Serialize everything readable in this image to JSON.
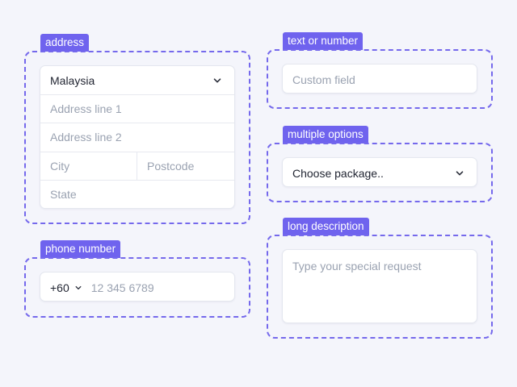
{
  "address": {
    "tag": "address",
    "country": "Malaysia",
    "line1_placeholder": "Address line 1",
    "line2_placeholder": "Address line 2",
    "city_placeholder": "City",
    "postcode_placeholder": "Postcode",
    "state_placeholder": "State"
  },
  "phone": {
    "tag": "phone number",
    "code": "+60",
    "placeholder": "12 345 6789"
  },
  "text_number": {
    "tag": "text or number",
    "placeholder": "Custom field"
  },
  "multiple": {
    "tag": "multiple options",
    "selected": "Choose package.."
  },
  "long": {
    "tag": "long description",
    "placeholder": "Type your special request"
  },
  "colors": {
    "accent": "#6f63ee",
    "background": "#f4f5fb"
  }
}
